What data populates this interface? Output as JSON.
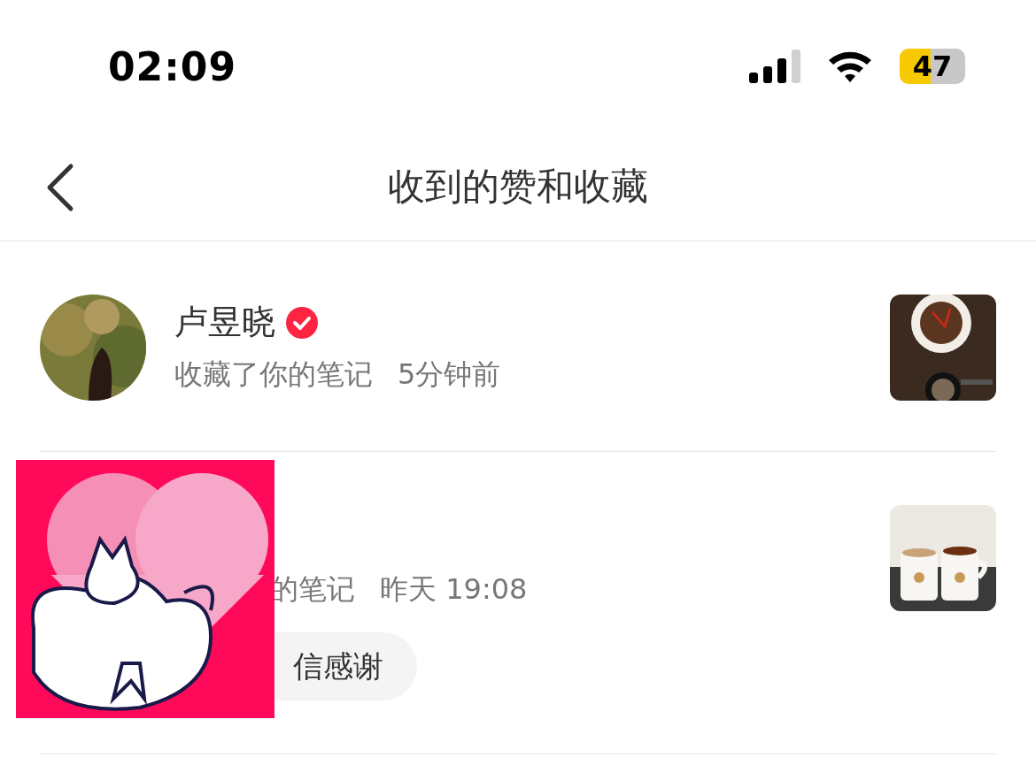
{
  "status_bar": {
    "time": "02:09",
    "battery": "47"
  },
  "header": {
    "title": "收到的赞和收藏"
  },
  "notifications": [
    {
      "name": "卢昱晓",
      "verified": true,
      "action": "收藏了你的笔记",
      "time": "5分钟前"
    },
    {
      "action": "的笔记",
      "time": "昨天 19:08",
      "reply_button": "信感谢"
    }
  ]
}
